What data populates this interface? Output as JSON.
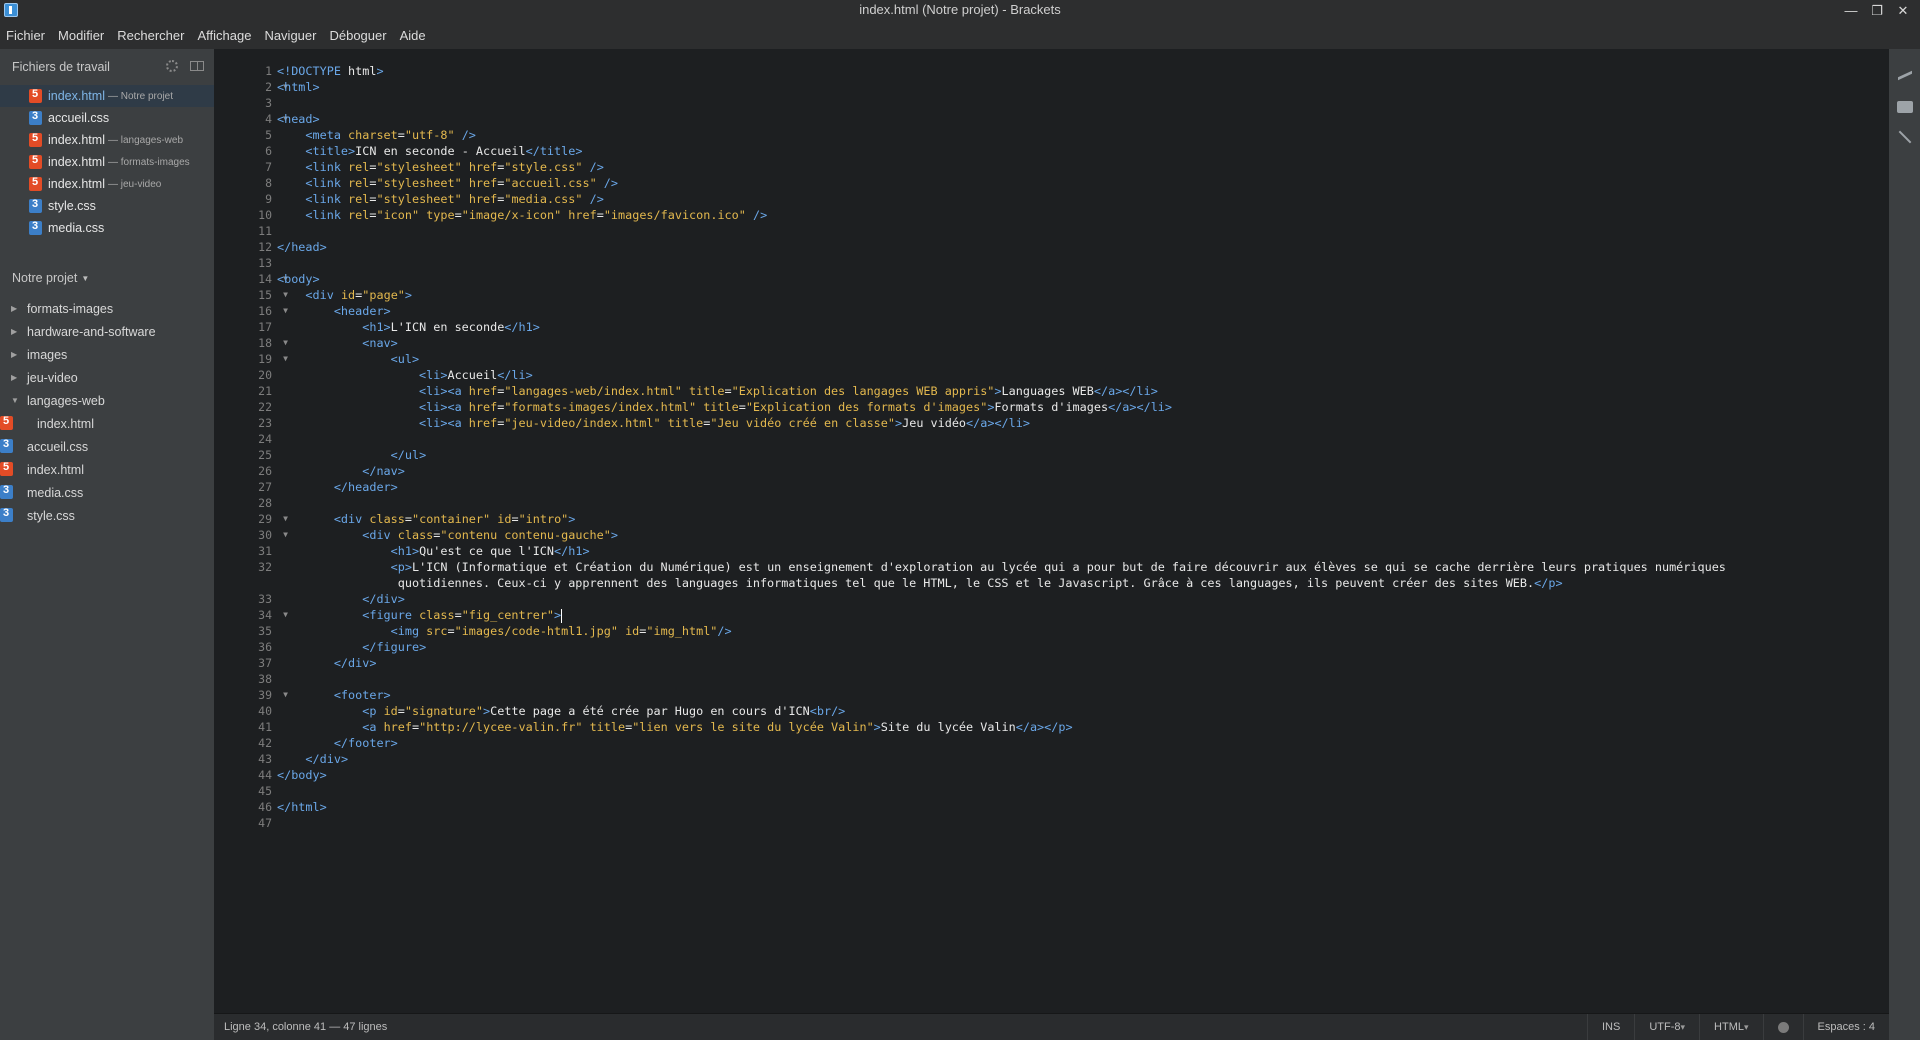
{
  "window": {
    "title": "index.html (Notre projet) - Brackets"
  },
  "menu": [
    "Fichier",
    "Modifier",
    "Rechercher",
    "Affichage",
    "Naviguer",
    "Déboguer",
    "Aide"
  ],
  "sidebar": {
    "working_files_title": "Fichiers de travail",
    "working_files": [
      {
        "name": "index.html",
        "dir": "— Notre projet",
        "type": "html",
        "active": true
      },
      {
        "name": "accueil.css",
        "dir": "",
        "type": "css"
      },
      {
        "name": "index.html",
        "dir": "— langages-web",
        "type": "html"
      },
      {
        "name": "index.html",
        "dir": "— formats-images",
        "type": "html"
      },
      {
        "name": "index.html",
        "dir": "— jeu-video",
        "type": "html"
      },
      {
        "name": "style.css",
        "dir": "",
        "type": "css"
      },
      {
        "name": "media.css",
        "dir": "",
        "type": "css"
      }
    ],
    "project_title": "Notre projet",
    "tree": {
      "folders": [
        "formats-images",
        "hardware-and-software",
        "images",
        "jeu-video",
        "langages-web"
      ],
      "nested_file": "index.html",
      "files": [
        "accueil.css",
        "index.html",
        "media.css",
        "style.css"
      ]
    }
  },
  "editor": {
    "lines": [
      "<!DOCTYPE html>",
      "<html>",
      "",
      "<head>",
      "<meta charset=\"utf-8\" />",
      "<title>ICN en seconde - Accueil</title>",
      "<link rel=\"stylesheet\" href=\"style.css\" />",
      "<link rel=\"stylesheet\" href=\"accueil.css\" />",
      "<link rel=\"stylesheet\" href=\"media.css\" />",
      "<link rel=\"icon\" type=\"image/x-icon\" href=\"images/favicon.ico\" />",
      "",
      "</head>",
      "",
      "<body>",
      "<div id=\"page\">",
      "<header>",
      "<h1>L'ICN en seconde</h1>",
      "<nav>",
      "<ul>",
      "<li>Accueil</li>",
      "<li><a href=\"langages-web/index.html\" title=\"Explication des langages WEB appris\">Languages WEB</a></li>",
      "<li><a href=\"formats-images/index.html\" title=\"Explication des formats d'images\">Formats d'images</a></li>",
      "<li><a href=\"jeu-video/index.html\" title=\"Jeu vidéo créé en classe\">Jeu vidéo</a></li>",
      "",
      "</ul>",
      "</nav>",
      "</header>",
      "",
      "<div class=\"container\" id=\"intro\">",
      "<div class=\"contenu contenu-gauche\">",
      "<h1>Qu'est ce que l'ICN</h1>",
      "<p>L'ICN (Informatique et Création du Numérique) est un enseignement d'exploration au lycée qui a pour but de faire découvrir aux élèves se qui se cache derrière leurs pratiques numériques quotidiennes. Ceux-ci y apprennent des languages informatiques tel que le HTML, le CSS et le Javascript. Grâce à ces languages, ils peuvent créer des sites WEB.</p>",
      "</div>",
      "<figure class=\"fig_centrer\">",
      "<img src=\"images/code-html1.jpg\" id=\"img_html\"/>",
      "</figure>",
      "</div>",
      "",
      "<footer>",
      "<p id=\"signature\">Cette page a été crée par Hugo en cours d'ICN<br/>",
      "<a href=\"http://lycee-valin.fr\" title=\"lien vers le site du lycée Valin\">Site du lycée Valin</a></p>",
      "</footer>",
      "</div>",
      "</body>",
      "",
      "</html>",
      ""
    ],
    "cursor_line": 34
  },
  "status": {
    "position": "Ligne 34, colonne 41 — 47 lignes",
    "mode": "INS",
    "encoding": "UTF-8",
    "language": "HTML",
    "indent": "Espaces : 4"
  }
}
